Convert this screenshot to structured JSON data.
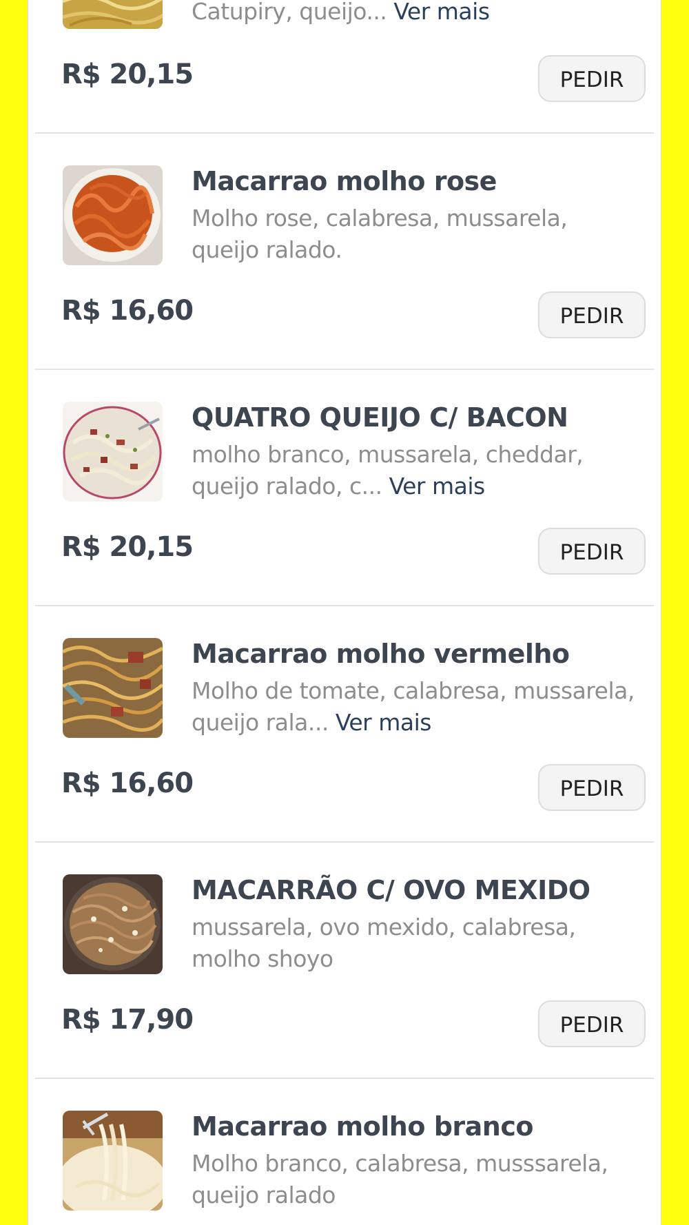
{
  "colors": {
    "page_background": "#FFFF10",
    "card_background": "#ffffff",
    "title_text": "#3d4550",
    "description_text": "#8d8d8d",
    "link_text": "#2b3f5c",
    "button_background": "#f4f4f4"
  },
  "items": [
    {
      "name": "",
      "description": "Catupiry, queijo...",
      "more": "Ver mais",
      "price": "R$ 20,15",
      "button": "PEDIR",
      "image_icon": "pasta-photo"
    },
    {
      "name": "Macarrao molho rose",
      "description": "Molho rose, calabresa, mussarela, queijo ralado.",
      "more": "",
      "price": "R$ 16,60",
      "button": "PEDIR",
      "image_icon": "pasta-photo"
    },
    {
      "name": "QUATRO QUEIJO C/ BACON",
      "description": "molho branco, mussarela, cheddar, queijo ralado, c...",
      "more": "Ver mais",
      "price": "R$ 20,15",
      "button": "PEDIR",
      "image_icon": "pasta-photo"
    },
    {
      "name": "Macarrao molho vermelho",
      "description": "Molho de tomate, calabresa, mussarela, queijo rala...",
      "more": "Ver mais",
      "price": "R$ 16,60",
      "button": "PEDIR",
      "image_icon": "pasta-photo"
    },
    {
      "name": "MACARRÃO C/ OVO MEXIDO",
      "description": "mussarela, ovo mexido, calabresa, molho shoyo",
      "more": "",
      "price": "R$ 17,90",
      "button": "PEDIR",
      "image_icon": "pasta-photo"
    },
    {
      "name": "Macarrao molho branco",
      "description": "Molho branco, calabresa, musssarela, queijo ralado",
      "more": "",
      "price": "",
      "button": "",
      "image_icon": "pasta-photo"
    }
  ]
}
